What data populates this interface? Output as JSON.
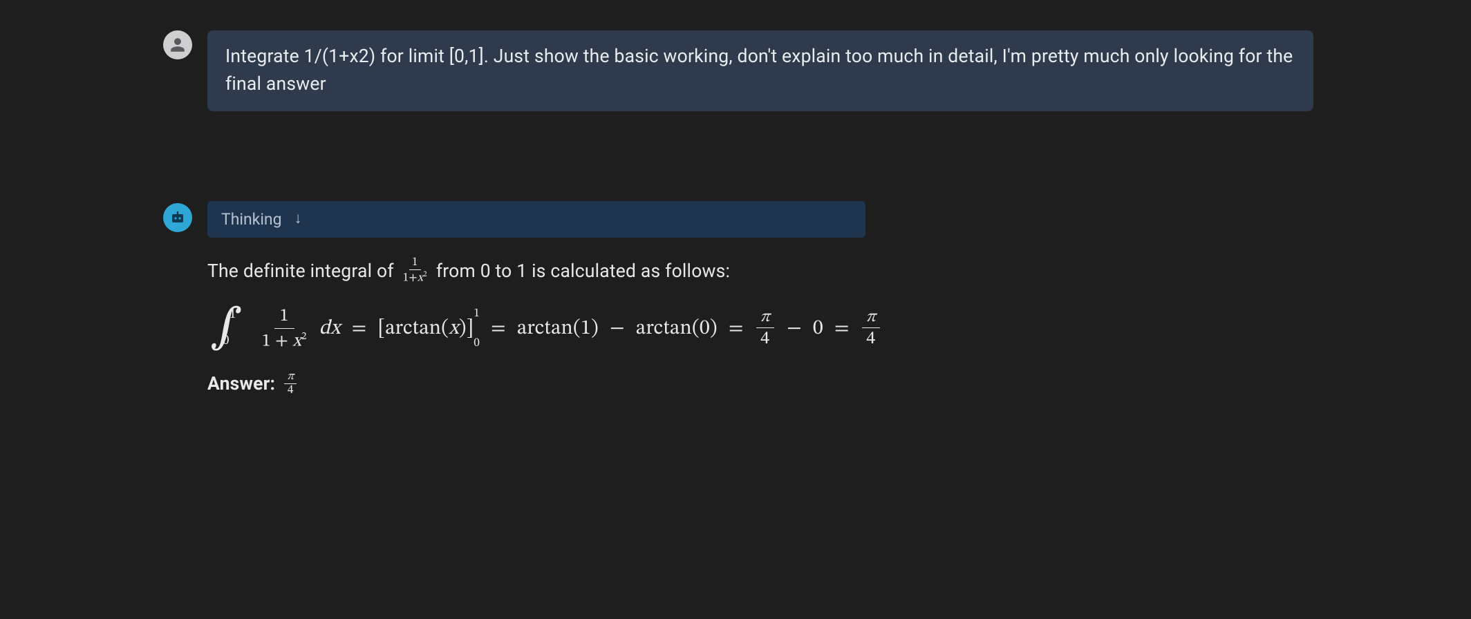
{
  "user_message": "Integrate 1/(1+x2) for limit [0,1]. Just show the basic working, don't explain too much in detail, I'm pretty much only looking for the final answer",
  "bot": {
    "thinking_label": "Thinking",
    "response_intro_pre": "The definite integral of ",
    "response_intro_post": " from 0 to 1 is calculated as follows:",
    "inline_frac_num": "1",
    "inline_frac_den_pre": "1+",
    "inline_frac_den_var": "x",
    "inline_frac_den_exp": "2",
    "eq": {
      "int_upper": "1",
      "int_lower": "0",
      "frac_num": "1",
      "frac_den_pre": "1 + ",
      "frac_den_var": "x",
      "frac_den_exp": "2",
      "dx": "dx",
      "eq1": "=",
      "lbr": "[",
      "arctan": "arctan",
      "arg_x": "x",
      "rbr": "]",
      "lim_up": "1",
      "lim_lo": "0",
      "eq2": "=",
      "arctan1": "arctan(1)",
      "minus1": "−",
      "arctan0": "arctan(0)",
      "eq3": "=",
      "pi": "π",
      "four": "4",
      "minus2": "−",
      "zero": "0",
      "eq4": "="
    },
    "answer_label": "Answer:",
    "answer_frac_num": "π",
    "answer_frac_den": "4"
  }
}
